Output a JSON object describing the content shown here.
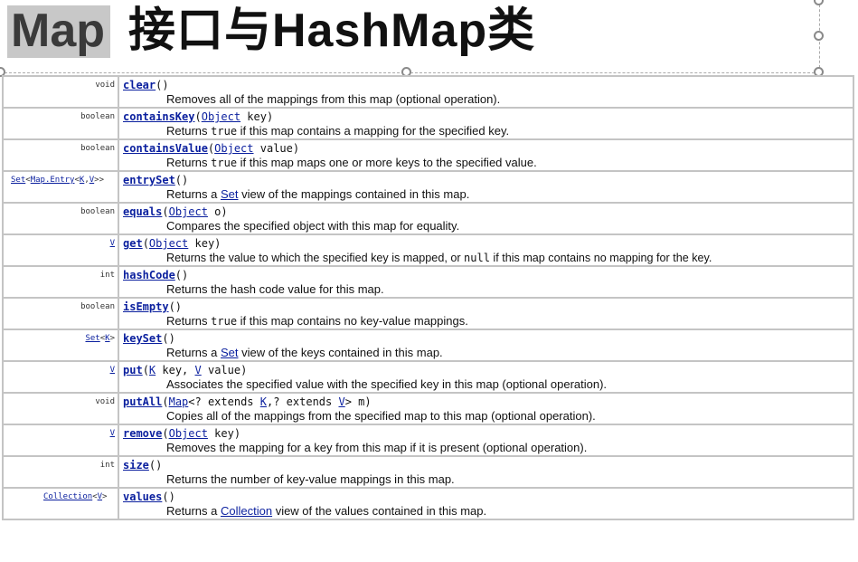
{
  "title": {
    "prefix": "Map",
    "rest": "接口与HashMap类"
  },
  "methods": [
    {
      "ret": "void",
      "name": "clear",
      "sig": "()",
      "desc": "Removes all of the mappings from this map (optional operation)."
    },
    {
      "ret": "boolean",
      "name": "containsKey",
      "open": "(",
      "param_type": "Object",
      "param_rest": " key)",
      "desc_a": "Returns ",
      "desc_code": "true",
      "desc_b": " if this map contains a mapping for the specified key."
    },
    {
      "ret": "boolean",
      "name": "containsValue",
      "open": "(",
      "param_type": "Object",
      "param_rest": " value)",
      "desc_a": "Returns ",
      "desc_code": "true",
      "desc_b": " if this map maps one or more keys to the specified value."
    },
    {
      "ret_set": "Set",
      "ret_lt": "<",
      "ret_entry": "Map.Entry",
      "ret_lt2": "<",
      "ret_k": "K",
      "ret_comma": ",",
      "ret_v": "V",
      "ret_gt": ">>",
      "name": "entrySet",
      "sig": "()",
      "desc_a": "Returns a ",
      "desc_link": "Set",
      "desc_b": " view of the mappings contained in this map."
    },
    {
      "ret": "boolean",
      "name": "equals",
      "open": "(",
      "param_type": "Object",
      "param_rest": " o)",
      "desc": "Compares the specified object with this map for equality."
    },
    {
      "ret_link": "V",
      "name": "get",
      "open": "(",
      "param_type": "Object",
      "param_rest": " key)",
      "desc_a": "Returns the value to which the specified key is mapped, or ",
      "desc_code": "null",
      "desc_b": " if this map contains no mapping for the key."
    },
    {
      "ret": "int",
      "name": "hashCode",
      "sig": "()",
      "desc": "Returns the hash code value for this map."
    },
    {
      "ret": "boolean",
      "name": "isEmpty",
      "sig": "()",
      "desc_a": "Returns ",
      "desc_code": "true",
      "desc_b": " if this map contains no key-value mappings."
    },
    {
      "ret_set": "Set",
      "ret_lt": "<",
      "ret_k": "K",
      "ret_gt": ">",
      "name": "keySet",
      "sig": "()",
      "desc_a": "Returns a ",
      "desc_link": "Set",
      "desc_b": " view of the keys contained in this map."
    },
    {
      "ret_link": "V",
      "name": "put",
      "open": "(",
      "p1_type": "K",
      "p1_rest": " key, ",
      "p2_type": "V",
      "p2_rest": " value)",
      "desc": "Associates the specified value with the specified key in this map (optional operation)."
    },
    {
      "ret": "void",
      "name": "putAll",
      "open": "(",
      "p1_type": "Map",
      "p1_rest": "<? extends ",
      "p2_type": "K",
      "p2_rest": ",? extends ",
      "p3_type": "V",
      "p3_rest": "> m)",
      "desc": "Copies all of the mappings from the specified map to this map (optional operation)."
    },
    {
      "ret_link": "V",
      "name": "remove",
      "open": "(",
      "param_type": "Object",
      "param_rest": " key)",
      "desc": "Removes the mapping for a key from this map if it is present (optional operation)."
    },
    {
      "ret": "int",
      "name": "size",
      "sig": "()",
      "desc": "Returns the number of key-value mappings in this map."
    },
    {
      "ret_coll": "Collection",
      "ret_lt": "<",
      "ret_v": "V",
      "ret_gt": ">",
      "name": "values",
      "sig": "()",
      "desc_a": "Returns a ",
      "desc_link": "Collection",
      "desc_b": " view of the values contained in this map."
    }
  ],
  "colors": {
    "link": "#0a1f9e",
    "grid": "#c4c4c4",
    "title_highlight": "#c8c8c8"
  }
}
